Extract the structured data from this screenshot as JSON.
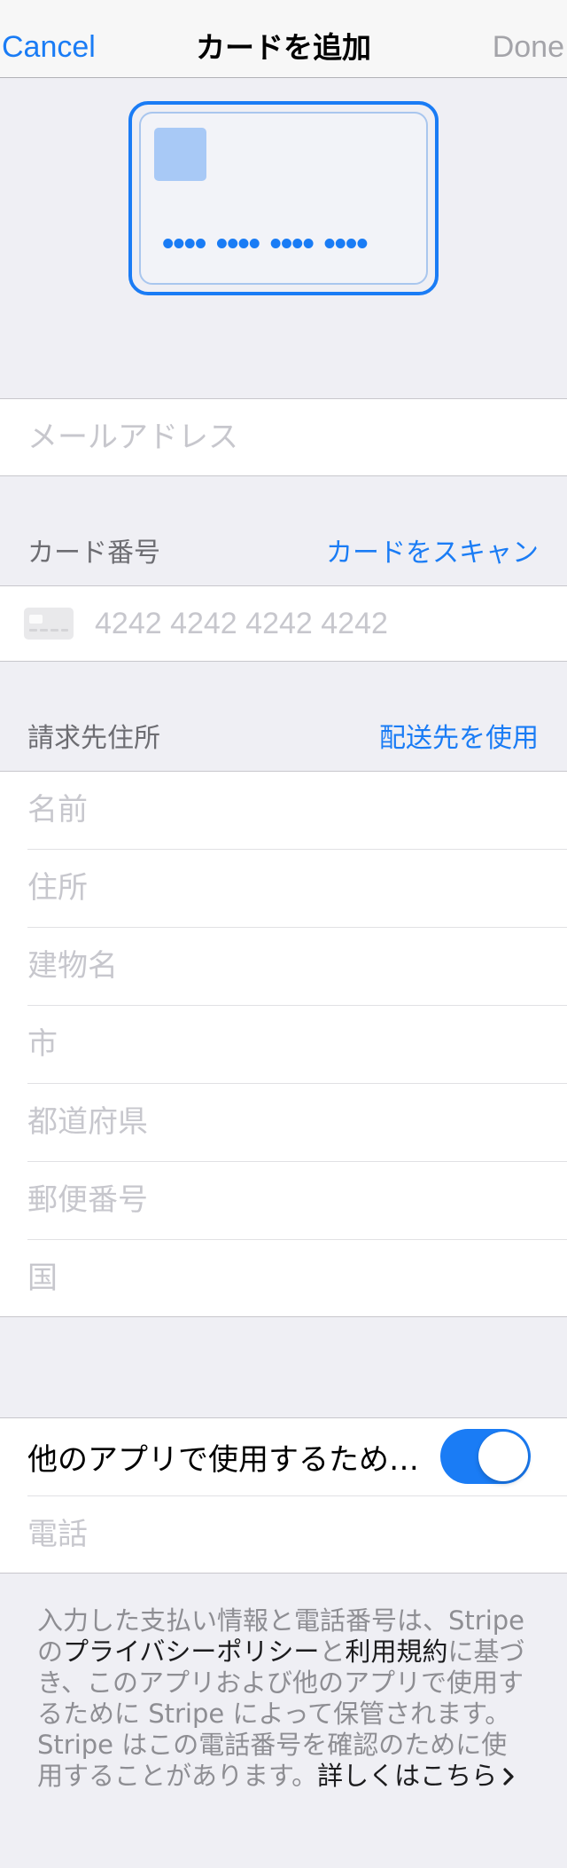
{
  "nav": {
    "cancel_label": "Cancel",
    "title": "カードを追加",
    "done_label": "Done",
    "done_enabled": false
  },
  "card_preview": {
    "number_mask": "•••• •••• •••• ••••"
  },
  "email": {
    "placeholder": "メールアドレス"
  },
  "card_section": {
    "header": "カード番号",
    "scan_label": "カードをスキャン",
    "card_icon": "credit-card-icon",
    "number_placeholder": "4242 4242 4242 4242"
  },
  "billing_section": {
    "header": "請求先住所",
    "use_shipping_label": "配送先を使用",
    "fields": [
      {
        "placeholder": "名前"
      },
      {
        "placeholder": "住所"
      },
      {
        "placeholder": "建物名"
      },
      {
        "placeholder": "市"
      },
      {
        "placeholder": "都道府県"
      },
      {
        "placeholder": "郵便番号"
      },
      {
        "placeholder": "国"
      }
    ]
  },
  "save_section": {
    "toggle_label": "他のアプリで使用するため…",
    "toggle_on": true,
    "phone_placeholder": "電話"
  },
  "footer": {
    "text_1": "入力した支払い情報と電話番号は、Stripe の",
    "privacy_link": "プライバシーポリシー",
    "text_2": "と",
    "terms_link": "利用規約",
    "text_3": "に基づき、このアプリおよび他のアプリで使用するために Stripe によって保管されます。Stripe はこの電話番号を確認のために使用することがあります。",
    "learn_more_link": "詳しくはこちら",
    "learn_more_icon": "chevron-right-icon"
  },
  "colors": {
    "accent": "#1a7cf5",
    "background": "#efeff4",
    "placeholder": "#c7c7cd",
    "section_header": "#6d6d72",
    "footer_text": "#8e8e93",
    "disabled": "#a4a4a9"
  }
}
